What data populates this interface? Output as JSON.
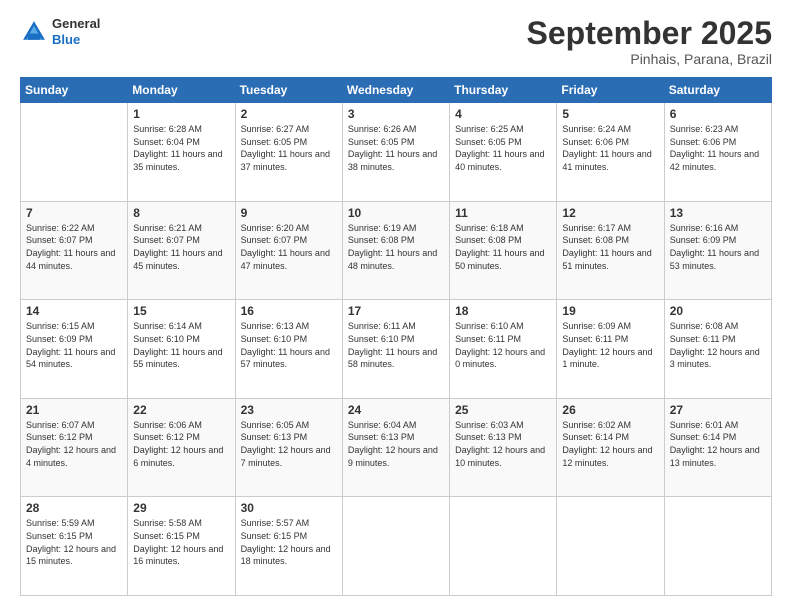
{
  "header": {
    "logo_general": "General",
    "logo_blue": "Blue",
    "month_title": "September 2025",
    "location": "Pinhais, Parana, Brazil"
  },
  "weekdays": [
    "Sunday",
    "Monday",
    "Tuesday",
    "Wednesday",
    "Thursday",
    "Friday",
    "Saturday"
  ],
  "weeks": [
    [
      {
        "day": "",
        "sunrise": "",
        "sunset": "",
        "daylight": ""
      },
      {
        "day": "1",
        "sunrise": "Sunrise: 6:28 AM",
        "sunset": "Sunset: 6:04 PM",
        "daylight": "Daylight: 11 hours and 35 minutes."
      },
      {
        "day": "2",
        "sunrise": "Sunrise: 6:27 AM",
        "sunset": "Sunset: 6:05 PM",
        "daylight": "Daylight: 11 hours and 37 minutes."
      },
      {
        "day": "3",
        "sunrise": "Sunrise: 6:26 AM",
        "sunset": "Sunset: 6:05 PM",
        "daylight": "Daylight: 11 hours and 38 minutes."
      },
      {
        "day": "4",
        "sunrise": "Sunrise: 6:25 AM",
        "sunset": "Sunset: 6:05 PM",
        "daylight": "Daylight: 11 hours and 40 minutes."
      },
      {
        "day": "5",
        "sunrise": "Sunrise: 6:24 AM",
        "sunset": "Sunset: 6:06 PM",
        "daylight": "Daylight: 11 hours and 41 minutes."
      },
      {
        "day": "6",
        "sunrise": "Sunrise: 6:23 AM",
        "sunset": "Sunset: 6:06 PM",
        "daylight": "Daylight: 11 hours and 42 minutes."
      }
    ],
    [
      {
        "day": "7",
        "sunrise": "Sunrise: 6:22 AM",
        "sunset": "Sunset: 6:07 PM",
        "daylight": "Daylight: 11 hours and 44 minutes."
      },
      {
        "day": "8",
        "sunrise": "Sunrise: 6:21 AM",
        "sunset": "Sunset: 6:07 PM",
        "daylight": "Daylight: 11 hours and 45 minutes."
      },
      {
        "day": "9",
        "sunrise": "Sunrise: 6:20 AM",
        "sunset": "Sunset: 6:07 PM",
        "daylight": "Daylight: 11 hours and 47 minutes."
      },
      {
        "day": "10",
        "sunrise": "Sunrise: 6:19 AM",
        "sunset": "Sunset: 6:08 PM",
        "daylight": "Daylight: 11 hours and 48 minutes."
      },
      {
        "day": "11",
        "sunrise": "Sunrise: 6:18 AM",
        "sunset": "Sunset: 6:08 PM",
        "daylight": "Daylight: 11 hours and 50 minutes."
      },
      {
        "day": "12",
        "sunrise": "Sunrise: 6:17 AM",
        "sunset": "Sunset: 6:08 PM",
        "daylight": "Daylight: 11 hours and 51 minutes."
      },
      {
        "day": "13",
        "sunrise": "Sunrise: 6:16 AM",
        "sunset": "Sunset: 6:09 PM",
        "daylight": "Daylight: 11 hours and 53 minutes."
      }
    ],
    [
      {
        "day": "14",
        "sunrise": "Sunrise: 6:15 AM",
        "sunset": "Sunset: 6:09 PM",
        "daylight": "Daylight: 11 hours and 54 minutes."
      },
      {
        "day": "15",
        "sunrise": "Sunrise: 6:14 AM",
        "sunset": "Sunset: 6:10 PM",
        "daylight": "Daylight: 11 hours and 55 minutes."
      },
      {
        "day": "16",
        "sunrise": "Sunrise: 6:13 AM",
        "sunset": "Sunset: 6:10 PM",
        "daylight": "Daylight: 11 hours and 57 minutes."
      },
      {
        "day": "17",
        "sunrise": "Sunrise: 6:11 AM",
        "sunset": "Sunset: 6:10 PM",
        "daylight": "Daylight: 11 hours and 58 minutes."
      },
      {
        "day": "18",
        "sunrise": "Sunrise: 6:10 AM",
        "sunset": "Sunset: 6:11 PM",
        "daylight": "Daylight: 12 hours and 0 minutes."
      },
      {
        "day": "19",
        "sunrise": "Sunrise: 6:09 AM",
        "sunset": "Sunset: 6:11 PM",
        "daylight": "Daylight: 12 hours and 1 minute."
      },
      {
        "day": "20",
        "sunrise": "Sunrise: 6:08 AM",
        "sunset": "Sunset: 6:11 PM",
        "daylight": "Daylight: 12 hours and 3 minutes."
      }
    ],
    [
      {
        "day": "21",
        "sunrise": "Sunrise: 6:07 AM",
        "sunset": "Sunset: 6:12 PM",
        "daylight": "Daylight: 12 hours and 4 minutes."
      },
      {
        "day": "22",
        "sunrise": "Sunrise: 6:06 AM",
        "sunset": "Sunset: 6:12 PM",
        "daylight": "Daylight: 12 hours and 6 minutes."
      },
      {
        "day": "23",
        "sunrise": "Sunrise: 6:05 AM",
        "sunset": "Sunset: 6:13 PM",
        "daylight": "Daylight: 12 hours and 7 minutes."
      },
      {
        "day": "24",
        "sunrise": "Sunrise: 6:04 AM",
        "sunset": "Sunset: 6:13 PM",
        "daylight": "Daylight: 12 hours and 9 minutes."
      },
      {
        "day": "25",
        "sunrise": "Sunrise: 6:03 AM",
        "sunset": "Sunset: 6:13 PM",
        "daylight": "Daylight: 12 hours and 10 minutes."
      },
      {
        "day": "26",
        "sunrise": "Sunrise: 6:02 AM",
        "sunset": "Sunset: 6:14 PM",
        "daylight": "Daylight: 12 hours and 12 minutes."
      },
      {
        "day": "27",
        "sunrise": "Sunrise: 6:01 AM",
        "sunset": "Sunset: 6:14 PM",
        "daylight": "Daylight: 12 hours and 13 minutes."
      }
    ],
    [
      {
        "day": "28",
        "sunrise": "Sunrise: 5:59 AM",
        "sunset": "Sunset: 6:15 PM",
        "daylight": "Daylight: 12 hours and 15 minutes."
      },
      {
        "day": "29",
        "sunrise": "Sunrise: 5:58 AM",
        "sunset": "Sunset: 6:15 PM",
        "daylight": "Daylight: 12 hours and 16 minutes."
      },
      {
        "day": "30",
        "sunrise": "Sunrise: 5:57 AM",
        "sunset": "Sunset: 6:15 PM",
        "daylight": "Daylight: 12 hours and 18 minutes."
      },
      {
        "day": "",
        "sunrise": "",
        "sunset": "",
        "daylight": ""
      },
      {
        "day": "",
        "sunrise": "",
        "sunset": "",
        "daylight": ""
      },
      {
        "day": "",
        "sunrise": "",
        "sunset": "",
        "daylight": ""
      },
      {
        "day": "",
        "sunrise": "",
        "sunset": "",
        "daylight": ""
      }
    ]
  ]
}
